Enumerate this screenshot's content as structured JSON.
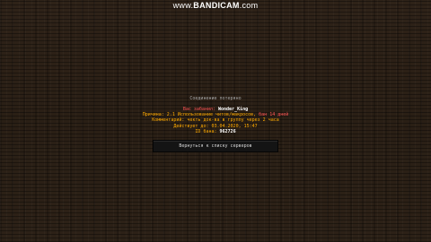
{
  "watermark": {
    "prefix": "www.",
    "brand": "BANDICAM",
    "suffix": ".com"
  },
  "screen": {
    "title": "Соединение потеряно",
    "banned_label": "Вас забанил: ",
    "banned_player": "Wonder_King",
    "reason_label": "Причина: 2.1 Использование читов/макросов, ",
    "reason_suffix": "бан 14 дней",
    "comment": "Комментарий: чекть док-ва в группу через 2 часа",
    "expires": "Действует до: 03.04.2020, 15:47",
    "ban_id_label": "ID бана: ",
    "ban_id_value": "962726",
    "back_button": "Вернуться к списку серверов"
  }
}
